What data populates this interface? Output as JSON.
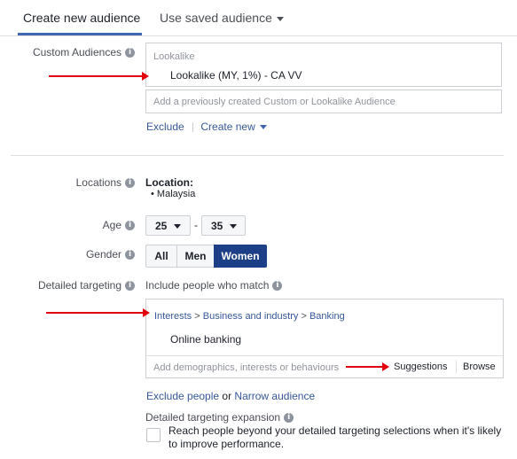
{
  "tabs": {
    "active": "Create new audience",
    "saved": "Use saved audience"
  },
  "custom_audiences": {
    "label": "Custom Audiences",
    "group_label": "Lookalike",
    "selected": "Lookalike (MY, 1%) - CA VV",
    "placeholder": "Add a previously created Custom or Lookalike Audience",
    "exclude": "Exclude",
    "create_new": "Create new"
  },
  "locations": {
    "label": "Locations",
    "title": "Location:",
    "items": [
      "Malaysia"
    ]
  },
  "age": {
    "label": "Age",
    "min": "25",
    "separator": "-",
    "max": "35"
  },
  "gender": {
    "label": "Gender",
    "options": [
      "All",
      "Men",
      "Women"
    ],
    "selected": "Women"
  },
  "detailed_targeting": {
    "label": "Detailed targeting",
    "include_label": "Include people who match",
    "breadcrumb": [
      "Interests",
      "Business and industry",
      "Banking"
    ],
    "breadcrumb_sep": ">",
    "interest": "Online banking",
    "placeholder": "Add demographics, interests or behaviours",
    "suggestions": "Suggestions",
    "browse": "Browse",
    "exclude_people": "Exclude people",
    "or": "or",
    "narrow": "Narrow audience"
  },
  "expansion": {
    "title": "Detailed targeting expansion",
    "description": "Reach people beyond your detailed targeting selections when it's likely to improve performance."
  },
  "colors": {
    "accent": "#4267b2",
    "link": "#365899",
    "selected_btn": "#1d3f87",
    "annotation_arrow": "#e3000f"
  }
}
